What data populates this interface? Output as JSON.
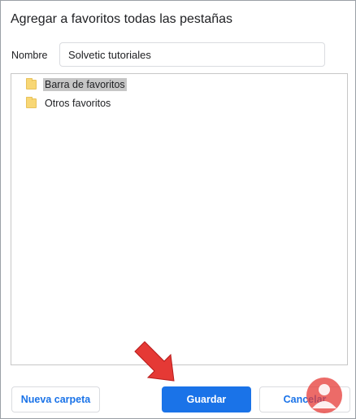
{
  "dialog": {
    "title": "Agregar a favoritos todas las pestañas",
    "name_label": "Nombre",
    "name_value": "Solvetic tutoriales"
  },
  "folders": [
    {
      "label": "Barra de favoritos",
      "selected": true,
      "icon": "folder-icon"
    },
    {
      "label": "Otros favoritos",
      "selected": false,
      "icon": "folder-icon"
    }
  ],
  "buttons": {
    "new_folder": "Nueva carpeta",
    "save": "Guardar",
    "cancel": "Cancelar"
  },
  "colors": {
    "accent": "#1a73e8",
    "selection": "#c6c6c6",
    "folder": "#f8d775",
    "arrow": "#e53935"
  },
  "overlay": {
    "arrow": "red-arrow-icon",
    "logo": "watermark-logo"
  }
}
